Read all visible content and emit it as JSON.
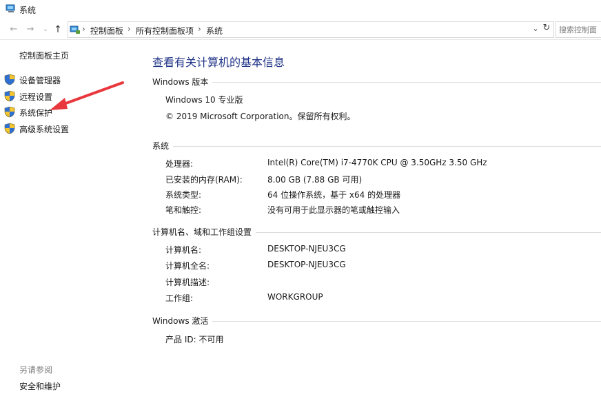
{
  "window": {
    "title": "系统"
  },
  "nav": {
    "breadcrumbs": [
      "控制面板",
      "所有控制面板项",
      "系统"
    ],
    "search_placeholder": "搜索控制面"
  },
  "left": {
    "home_label": "控制面板主页",
    "tasks": [
      {
        "label": "设备管理器",
        "icon": "shield-icon"
      },
      {
        "label": "远程设置",
        "icon": "shield-icon"
      },
      {
        "label": "系统保护",
        "icon": "shield-icon"
      },
      {
        "label": "高级系统设置",
        "icon": "shield-icon"
      }
    ],
    "see_also_label": "另请参阅",
    "see_also_links": [
      "安全和维护"
    ]
  },
  "main": {
    "title": "查看有关计算机的基本信息",
    "edition": {
      "header": "Windows 版本",
      "name": "Windows 10 专业版",
      "copyright": "© 2019 Microsoft Corporation。保留所有权利。"
    },
    "system": {
      "header": "系统",
      "rows": [
        {
          "label": "处理器:",
          "value": "Intel(R) Core(TM) i7-4770K CPU @ 3.50GHz   3.50 GHz"
        },
        {
          "label": "已安装的内存(RAM):",
          "value": "8.00 GB (7.88 GB 可用)"
        },
        {
          "label": "系统类型:",
          "value": "64 位操作系统，基于 x64 的处理器"
        },
        {
          "label": "笔和触控:",
          "value": "没有可用于此显示器的笔或触控输入"
        }
      ]
    },
    "computer": {
      "header": "计算机名、域和工作组设置",
      "rows": [
        {
          "label": "计算机名:",
          "value": "DESKTOP-NJEU3CG"
        },
        {
          "label": "计算机全名:",
          "value": "DESKTOP-NJEU3CG"
        },
        {
          "label": "计算机描述:",
          "value": ""
        },
        {
          "label": "工作组:",
          "value": "WORKGROUP"
        }
      ]
    },
    "activation": {
      "header": "Windows 激活",
      "product_id": "产品 ID: 不可用"
    }
  },
  "colors": {
    "title_blue": "#1e3287",
    "arrow_red": "#e8383d",
    "section_line": "#dcdcdc"
  }
}
